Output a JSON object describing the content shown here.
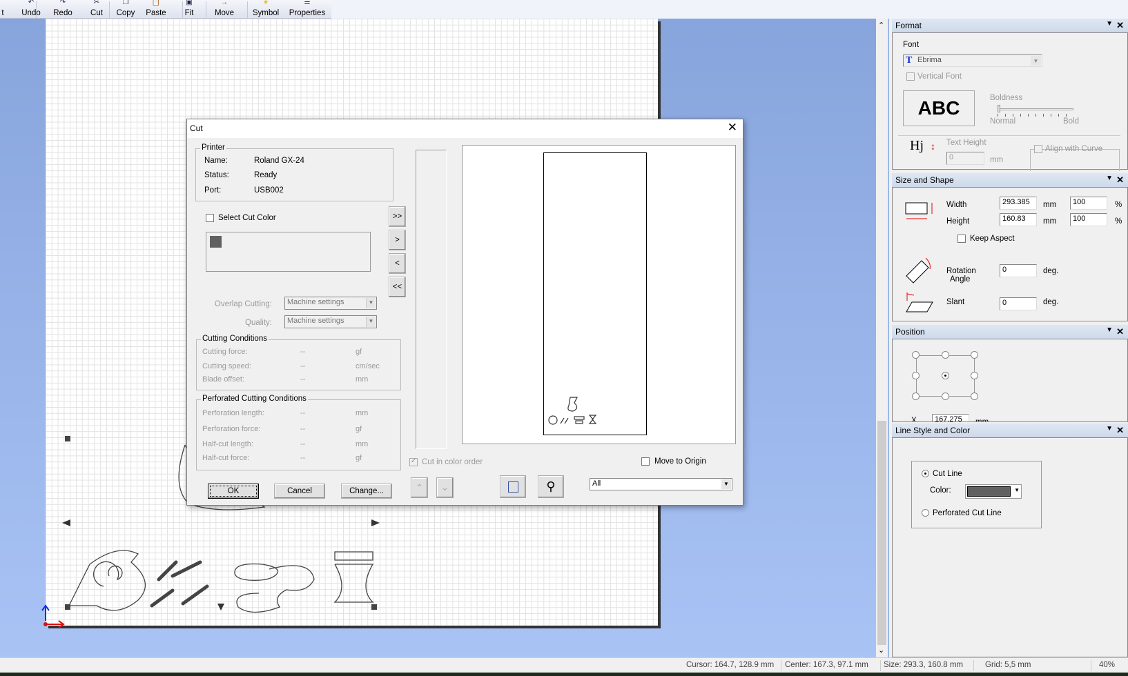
{
  "toolbar": {
    "items": [
      {
        "label": "t",
        "icon": "truncated-icon"
      },
      {
        "label": "Undo",
        "icon": "undo-icon"
      },
      {
        "label": "Redo",
        "icon": "redo-icon"
      },
      {
        "label": "Cut",
        "icon": "scissors-icon"
      },
      {
        "label": "Copy",
        "icon": "copy-icon"
      },
      {
        "label": "Paste",
        "icon": "paste-icon"
      },
      {
        "label": "Fit",
        "icon": "fit-icon"
      },
      {
        "label": "Move",
        "icon": "move-icon"
      },
      {
        "label": "Symbol",
        "icon": "star-icon"
      },
      {
        "label": "Properties",
        "icon": "properties-icon"
      }
    ]
  },
  "dialog": {
    "title": "Cut",
    "printer": {
      "group": "Printer",
      "name_label": "Name:",
      "name": "Roland GX-24",
      "status_label": "Status:",
      "status": "Ready",
      "port_label": "Port:",
      "port": "USB002"
    },
    "select_cut_color": "Select Cut Color",
    "select_cut_color_checked": false,
    "swatch_color": "#606060",
    "move_buttons": [
      ">>",
      ">",
      "<",
      "<<"
    ],
    "overlap_label": "Overlap Cutting:",
    "overlap_value": "Machine settings",
    "quality_label": "Quality:",
    "quality_value": "Machine settings",
    "cutting": {
      "group": "Cutting Conditions",
      "rows": [
        {
          "label": "Cutting force:",
          "value": "--",
          "unit": "gf"
        },
        {
          "label": "Cutting speed:",
          "value": "--",
          "unit": "cm/sec"
        },
        {
          "label": "Blade offset:",
          "value": "--",
          "unit": "mm"
        }
      ]
    },
    "perforated": {
      "group": "Perforated Cutting Conditions",
      "rows": [
        {
          "label": "Perforation length:",
          "value": "--",
          "unit": "mm"
        },
        {
          "label": "Perforation  force:",
          "value": "--",
          "unit": "gf"
        },
        {
          "label": "Half-cut length:",
          "value": "--",
          "unit": "mm"
        },
        {
          "label": "Half-cut force:",
          "value": "--",
          "unit": "gf"
        }
      ]
    },
    "cut_in_color_order": "Cut in color order",
    "cut_in_color_order_checked": true,
    "move_to_origin": "Move to Origin",
    "move_to_origin_checked": false,
    "ok": "OK",
    "cancel": "Cancel",
    "change": "Change...",
    "filter_value": "All"
  },
  "format": {
    "title": "Format",
    "font_label": "Font",
    "font_value": "Ebrima",
    "vertical_font": "Vertical Font",
    "preview": "ABC",
    "boldness": "Boldness",
    "normal": "Normal",
    "bold": "Bold",
    "hj": "Hj",
    "text_height": "Text Height",
    "text_height_value": "0",
    "mm": "mm",
    "align_curve": "Align with Curve"
  },
  "size_shape": {
    "title": "Size and Shape",
    "width_label": "Width",
    "width": "293.385",
    "width_pct": "100",
    "height_label": "Height",
    "height": "160.83",
    "height_pct": "100",
    "mm": "mm",
    "pct": "%",
    "keep_aspect": "Keep Aspect",
    "rotation1": "Rotation",
    "rotation2": "Angle",
    "rotation": "0",
    "slant_label": "Slant",
    "slant": "0",
    "deg": "deg."
  },
  "position": {
    "title": "Position",
    "x_label": "X",
    "x": "167.275",
    "mm": "mm",
    "selected_anchor": "center"
  },
  "line_style": {
    "title": "Line Style and Color",
    "cut_line": "Cut Line",
    "color_label": "Color:",
    "color": "#606060",
    "perforated": "Perforated Cut Line",
    "selected": "Cut Line"
  },
  "status": {
    "cursor": "Cursor: 164.7, 128.9 mm",
    "center": "Center: 167.3, 97.1 mm",
    "size": "Size: 293.3, 160.8 mm",
    "grid": "Grid: 5,5 mm",
    "zoom": "40%"
  }
}
